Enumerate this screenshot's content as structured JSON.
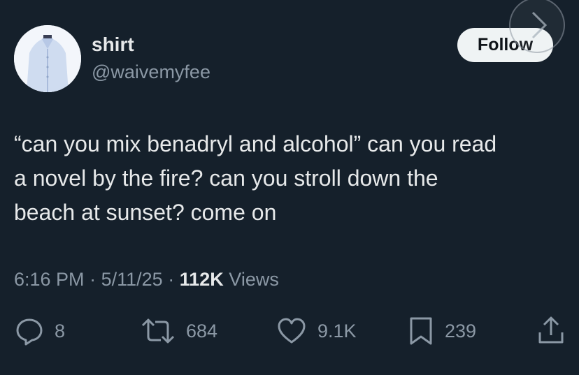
{
  "user": {
    "name": "shirt",
    "handle": "@waivemyfee",
    "follow_label": "Follow"
  },
  "tweet": {
    "lines": [
      "“can you mix benadryl and alcohol” can you read",
      "a novel by the fire? can you stroll down the",
      "beach at sunset? come on"
    ]
  },
  "meta": {
    "time": "6:16 PM",
    "date": "5/11/25",
    "separator": "·",
    "views_count": "112K",
    "views_label": "Views"
  },
  "actions": {
    "replies": "8",
    "reposts": "684",
    "likes": "9.1K",
    "bookmarks": "239"
  },
  "icons": {
    "reply": "reply-icon",
    "repost": "repost-icon",
    "like": "heart-icon",
    "bookmark": "bookmark-icon",
    "share": "share-icon",
    "next": "chevron-right-icon"
  },
  "colors": {
    "background": "#15202b",
    "text": "#e7e9ea",
    "secondary": "#8b98a5",
    "follow_bg": "#eff3f4"
  }
}
